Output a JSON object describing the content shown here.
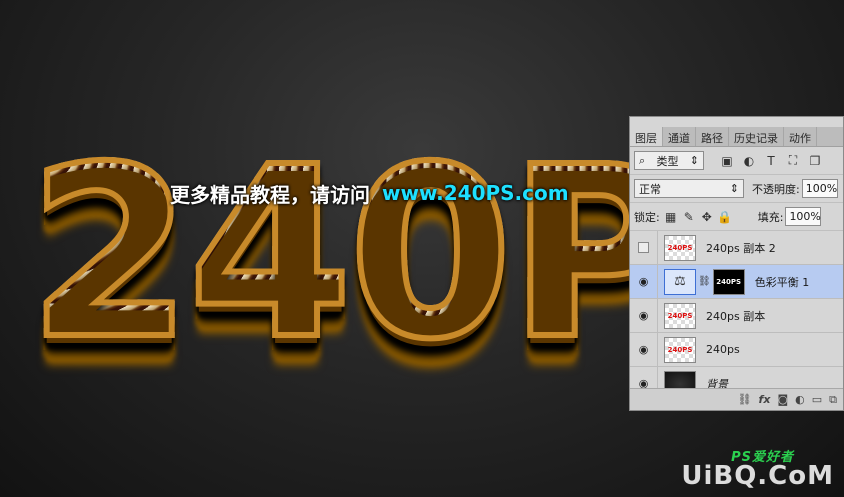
{
  "artwork": {
    "big_text": "240P",
    "banner_cn": "更多精品教程，请访问",
    "banner_url": "www.240PS.com"
  },
  "layers_panel": {
    "tabs": [
      {
        "label": "图层",
        "active": true
      },
      {
        "label": "通道",
        "active": false
      },
      {
        "label": "路径",
        "active": false
      },
      {
        "label": "历史记录",
        "active": false
      },
      {
        "label": "动作",
        "active": false
      }
    ],
    "filter_kind": "类型",
    "filter_search_icon": "search-icon",
    "blend_mode": "正常",
    "opacity_label": "不透明度:",
    "opacity_value": "100%",
    "lock_label": "锁定:",
    "fill_label": "填充:",
    "fill_value": "100%",
    "layers": [
      {
        "name": "240ps 副本 2",
        "visible": false,
        "thumb": "240PS",
        "selected": false
      },
      {
        "name": "色彩平衡 1",
        "visible": true,
        "thumb": "balance",
        "mask": "240PS",
        "selected": true
      },
      {
        "name": "240ps 副本",
        "visible": true,
        "thumb": "240PS",
        "selected": false
      },
      {
        "name": "240ps",
        "visible": true,
        "thumb": "240PS",
        "selected": false
      },
      {
        "name": "背景",
        "visible": true,
        "thumb": "",
        "selected": false
      }
    ]
  },
  "watermark": {
    "site": "UiBQ.CoM",
    "ps_text": "PS爱好者"
  }
}
